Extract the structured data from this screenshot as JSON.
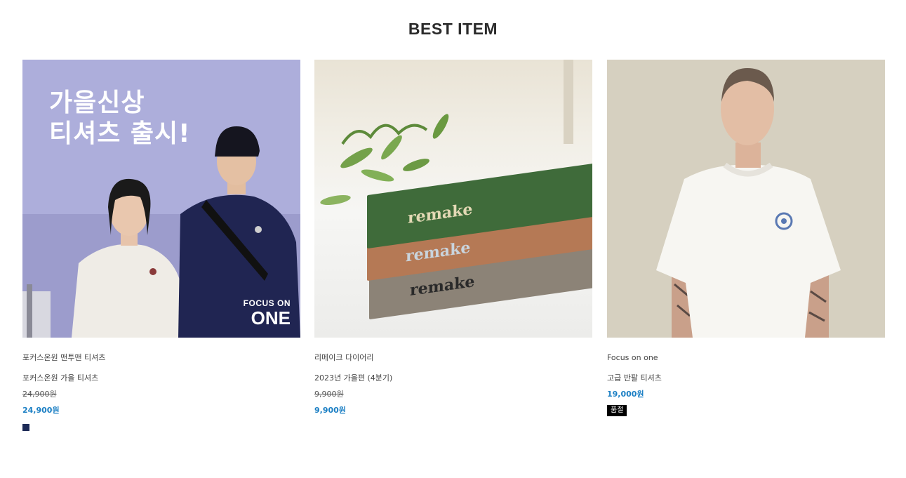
{
  "section": {
    "title": "BEST ITEM"
  },
  "products": [
    {
      "image_headline_1": "가을신상",
      "image_headline_2": "티셔츠 출시!",
      "image_brand_1": "FOCUS ON",
      "image_brand_2": "ONE",
      "brand": "포커스온원 맨투맨 티셔츠",
      "name": "포커스온원 가을 티셔츠",
      "original_price": "24,900원",
      "price": "24,900원",
      "swatch_color": "#1d2b57"
    },
    {
      "book_word": "remake",
      "brand": "리메이크 다이어리",
      "name": "2023년 가을편 (4분기)",
      "original_price": "9,900원",
      "price": "9,900원"
    },
    {
      "brand": "Focus on one",
      "name": "고급 반팔 티셔츠",
      "price": "19,000원",
      "badge": "품절"
    }
  ],
  "colors": {
    "price": "#1b7fc4",
    "title": "#2b2b2b",
    "soldout_bg": "#000000"
  }
}
